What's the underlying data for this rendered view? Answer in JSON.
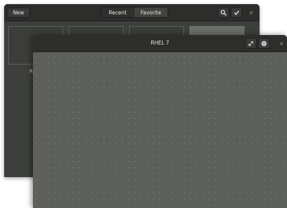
{
  "back_window": {
    "header": {
      "new_label": "New",
      "tabs": [
        {
          "label": "Recent",
          "active": false
        },
        {
          "label": "Favorite",
          "active": true
        }
      ],
      "search_icon": "search-icon",
      "select_icon": "checkmark-icon",
      "close_glyph": "×"
    },
    "thumbnails": [
      {
        "label": "RI"
      }
    ]
  },
  "front_window": {
    "title": "RHEL 7",
    "fullscreen_icon": "fullscreen-icon",
    "properties_icon": "gear-icon",
    "close_glyph": "×"
  }
}
